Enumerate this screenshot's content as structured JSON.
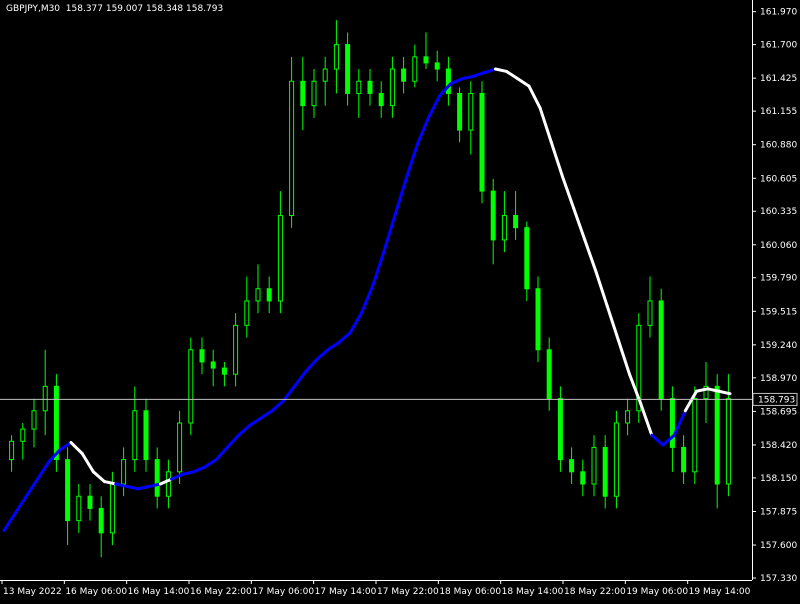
{
  "header": {
    "symbol_timeframe": "GBPJPY,M30",
    "ohlc": "158.377 159.007 158.348 158.793"
  },
  "current_price_label": "158.793",
  "colors": {
    "background": "#000000",
    "axis": "#ffffff",
    "bull_candle": "#00ff00",
    "bear_candle": "#00ff00",
    "ma_up": "#0000ff",
    "ma_down": "#ffffff",
    "price_line": "#c0c0c0"
  },
  "chart_data": {
    "type": "candlestick",
    "y_ticks": [
      "161.970",
      "161.700",
      "161.425",
      "161.155",
      "160.880",
      "160.605",
      "160.335",
      "160.060",
      "159.790",
      "159.515",
      "159.240",
      "158.970",
      "158.695",
      "158.420",
      "158.150",
      "157.875",
      "157.600",
      "157.330"
    ],
    "ylim": [
      157.33,
      162.0
    ],
    "x_ticks": [
      "13 May 2022",
      "16 May 06:00",
      "16 May 14:00",
      "16 May 22:00",
      "17 May 06:00",
      "17 May 14:00",
      "17 May 22:00",
      "18 May 06:00",
      "18 May 14:00",
      "18 May 22:00",
      "19 May 06:00",
      "19 May 14:00"
    ],
    "current_price": 158.793,
    "ma_values": [
      157.72,
      157.86,
      158.0,
      158.14,
      158.28,
      158.38,
      158.44,
      158.35,
      158.2,
      158.12,
      158.1,
      158.08,
      158.06,
      158.08,
      158.1,
      158.14,
      158.18,
      158.2,
      158.24,
      158.3,
      158.4,
      158.5,
      158.58,
      158.64,
      158.7,
      158.78,
      158.9,
      159.02,
      159.12,
      159.2,
      159.26,
      159.34,
      159.5,
      159.72,
      160.0,
      160.3,
      160.6,
      160.88,
      161.1,
      161.28,
      161.38,
      161.42,
      161.44,
      161.47,
      161.5,
      161.48,
      161.42,
      161.36,
      161.18,
      160.9,
      160.62,
      160.36,
      160.1,
      159.84,
      159.56,
      159.28,
      159.0,
      158.76,
      158.5,
      158.42,
      158.5,
      158.7,
      158.86,
      158.88,
      158.86,
      158.84
    ],
    "ma_direction": [
      "up",
      "up",
      "up",
      "up",
      "up",
      "up",
      "up",
      "down",
      "down",
      "down",
      "down",
      "up",
      "up",
      "up",
      "up",
      "down",
      "up",
      "up",
      "up",
      "up",
      "up",
      "up",
      "up",
      "up",
      "up",
      "up",
      "up",
      "up",
      "up",
      "up",
      "up",
      "up",
      "up",
      "up",
      "up",
      "up",
      "up",
      "up",
      "up",
      "up",
      "up",
      "up",
      "up",
      "up",
      "up",
      "down",
      "down",
      "down",
      "down",
      "down",
      "down",
      "down",
      "down",
      "down",
      "down",
      "down",
      "down",
      "down",
      "down",
      "up",
      "up",
      "up",
      "down",
      "down",
      "down",
      "down"
    ],
    "candles": [
      {
        "o": 158.3,
        "h": 158.5,
        "l": 158.2,
        "c": 158.45
      },
      {
        "o": 158.45,
        "h": 158.6,
        "l": 158.3,
        "c": 158.55
      },
      {
        "o": 158.55,
        "h": 158.8,
        "l": 158.4,
        "c": 158.7
      },
      {
        "o": 158.7,
        "h": 159.2,
        "l": 158.5,
        "c": 158.9
      },
      {
        "o": 158.9,
        "h": 159.0,
        "l": 158.2,
        "c": 158.3
      },
      {
        "o": 158.3,
        "h": 158.4,
        "l": 157.6,
        "c": 157.8
      },
      {
        "o": 157.8,
        "h": 158.1,
        "l": 157.7,
        "c": 158.0
      },
      {
        "o": 158.0,
        "h": 158.1,
        "l": 157.8,
        "c": 157.9
      },
      {
        "o": 157.9,
        "h": 158.0,
        "l": 157.5,
        "c": 157.7
      },
      {
        "o": 157.7,
        "h": 158.2,
        "l": 157.6,
        "c": 158.1
      },
      {
        "o": 158.1,
        "h": 158.4,
        "l": 158.0,
        "c": 158.3
      },
      {
        "o": 158.3,
        "h": 158.9,
        "l": 158.2,
        "c": 158.7
      },
      {
        "o": 158.7,
        "h": 158.8,
        "l": 158.2,
        "c": 158.3
      },
      {
        "o": 158.3,
        "h": 158.4,
        "l": 157.9,
        "c": 158.0
      },
      {
        "o": 158.0,
        "h": 158.3,
        "l": 157.9,
        "c": 158.2
      },
      {
        "o": 158.2,
        "h": 158.7,
        "l": 158.1,
        "c": 158.6
      },
      {
        "o": 158.6,
        "h": 159.3,
        "l": 158.5,
        "c": 159.2
      },
      {
        "o": 159.2,
        "h": 159.3,
        "l": 159.0,
        "c": 159.1
      },
      {
        "o": 159.1,
        "h": 159.2,
        "l": 158.9,
        "c": 159.05
      },
      {
        "o": 159.05,
        "h": 159.1,
        "l": 158.9,
        "c": 159.0
      },
      {
        "o": 159.0,
        "h": 159.5,
        "l": 158.9,
        "c": 159.4
      },
      {
        "o": 159.4,
        "h": 159.8,
        "l": 159.3,
        "c": 159.6
      },
      {
        "o": 159.6,
        "h": 159.9,
        "l": 159.5,
        "c": 159.7
      },
      {
        "o": 159.7,
        "h": 159.8,
        "l": 159.5,
        "c": 159.6
      },
      {
        "o": 159.6,
        "h": 160.5,
        "l": 159.5,
        "c": 160.3
      },
      {
        "o": 160.3,
        "h": 161.6,
        "l": 160.2,
        "c": 161.4
      },
      {
        "o": 161.4,
        "h": 161.6,
        "l": 161.0,
        "c": 161.2
      },
      {
        "o": 161.2,
        "h": 161.5,
        "l": 161.1,
        "c": 161.4
      },
      {
        "o": 161.4,
        "h": 161.6,
        "l": 161.2,
        "c": 161.5
      },
      {
        "o": 161.5,
        "h": 161.9,
        "l": 161.3,
        "c": 161.7
      },
      {
        "o": 161.7,
        "h": 161.8,
        "l": 161.2,
        "c": 161.3
      },
      {
        "o": 161.3,
        "h": 161.5,
        "l": 161.1,
        "c": 161.4
      },
      {
        "o": 161.4,
        "h": 161.5,
        "l": 161.2,
        "c": 161.3
      },
      {
        "o": 161.3,
        "h": 161.4,
        "l": 161.1,
        "c": 161.2
      },
      {
        "o": 161.2,
        "h": 161.6,
        "l": 161.1,
        "c": 161.5
      },
      {
        "o": 161.5,
        "h": 161.6,
        "l": 161.3,
        "c": 161.4
      },
      {
        "o": 161.4,
        "h": 161.7,
        "l": 161.35,
        "c": 161.6
      },
      {
        "o": 161.6,
        "h": 161.8,
        "l": 161.5,
        "c": 161.55
      },
      {
        "o": 161.55,
        "h": 161.65,
        "l": 161.4,
        "c": 161.5
      },
      {
        "o": 161.5,
        "h": 161.6,
        "l": 161.2,
        "c": 161.3
      },
      {
        "o": 161.3,
        "h": 161.35,
        "l": 160.9,
        "c": 161.0
      },
      {
        "o": 161.0,
        "h": 161.4,
        "l": 160.8,
        "c": 161.3
      },
      {
        "o": 161.3,
        "h": 161.4,
        "l": 160.4,
        "c": 160.5
      },
      {
        "o": 160.5,
        "h": 160.6,
        "l": 159.9,
        "c": 160.1
      },
      {
        "o": 160.1,
        "h": 160.5,
        "l": 160.0,
        "c": 160.3
      },
      {
        "o": 160.3,
        "h": 160.5,
        "l": 160.1,
        "c": 160.2
      },
      {
        "o": 160.2,
        "h": 160.25,
        "l": 159.6,
        "c": 159.7
      },
      {
        "o": 159.7,
        "h": 159.8,
        "l": 159.1,
        "c": 159.2
      },
      {
        "o": 159.2,
        "h": 159.3,
        "l": 158.7,
        "c": 158.8
      },
      {
        "o": 158.8,
        "h": 158.9,
        "l": 158.2,
        "c": 158.3
      },
      {
        "o": 158.3,
        "h": 158.4,
        "l": 158.1,
        "c": 158.2
      },
      {
        "o": 158.2,
        "h": 158.3,
        "l": 158.0,
        "c": 158.1
      },
      {
        "o": 158.1,
        "h": 158.5,
        "l": 158.0,
        "c": 158.4
      },
      {
        "o": 158.4,
        "h": 158.5,
        "l": 157.9,
        "c": 158.0
      },
      {
        "o": 158.0,
        "h": 158.7,
        "l": 157.9,
        "c": 158.6
      },
      {
        "o": 158.6,
        "h": 158.8,
        "l": 158.5,
        "c": 158.7
      },
      {
        "o": 158.7,
        "h": 159.5,
        "l": 158.6,
        "c": 159.4
      },
      {
        "o": 159.4,
        "h": 159.8,
        "l": 159.3,
        "c": 159.6
      },
      {
        "o": 159.6,
        "h": 159.7,
        "l": 158.7,
        "c": 158.8
      },
      {
        "o": 158.8,
        "h": 158.9,
        "l": 158.2,
        "c": 158.4
      },
      {
        "o": 158.4,
        "h": 158.5,
        "l": 158.1,
        "c": 158.2
      },
      {
        "o": 158.2,
        "h": 158.9,
        "l": 158.1,
        "c": 158.8
      },
      {
        "o": 158.8,
        "h": 159.1,
        "l": 158.6,
        "c": 158.9
      },
      {
        "o": 158.9,
        "h": 159.0,
        "l": 157.9,
        "c": 158.1
      },
      {
        "o": 158.1,
        "h": 159.0,
        "l": 158.0,
        "c": 158.8
      }
    ]
  }
}
